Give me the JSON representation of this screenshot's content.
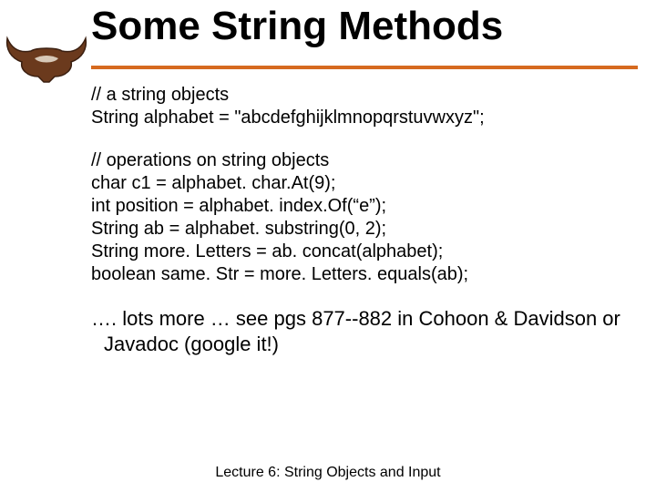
{
  "title": "Some String Methods",
  "code_block1": {
    "l1": "// a string objects",
    "l2": "String alphabet = \"abcdefghijklmnopqrstuvwxyz\";"
  },
  "code_block2": {
    "l1": "// operations on string objects",
    "l2": "char c1 = alphabet. char.At(9);",
    "l3": "int position = alphabet. index.Of(“e”);",
    "l4": "String ab = alphabet. substring(0, 2);",
    "l5": "String more. Letters = ab. concat(alphabet);",
    "l6": "boolean same. Str = more. Letters. equals(ab);"
  },
  "note": "…. lots more … see pgs 877--882 in Cohoon & Davidson or Javadoc (google it!)",
  "footer": "Lecture 6: String Objects and Input"
}
